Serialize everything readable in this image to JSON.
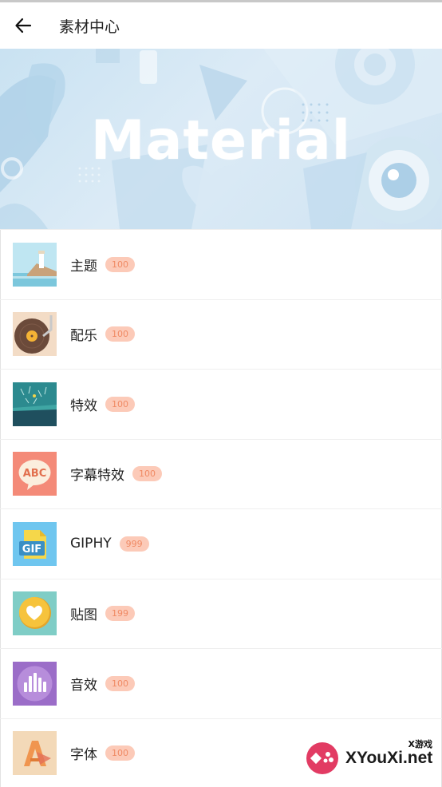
{
  "header": {
    "title": "素材中心",
    "back_icon": "arrow-left-icon"
  },
  "banner": {
    "text": "Material"
  },
  "items": [
    {
      "label": "主题",
      "count": "100",
      "icon": "theme-lighthouse-icon"
    },
    {
      "label": "配乐",
      "count": "100",
      "icon": "music-record-icon"
    },
    {
      "label": "特效",
      "count": "100",
      "icon": "effects-icon"
    },
    {
      "label": "字幕特效",
      "count": "100",
      "icon": "subtitle-abc-icon"
    },
    {
      "label": "GIPHY",
      "count": "999",
      "icon": "gif-icon"
    },
    {
      "label": "贴图",
      "count": "199",
      "icon": "sticker-heart-icon"
    },
    {
      "label": "音效",
      "count": "100",
      "icon": "sound-bars-icon"
    },
    {
      "label": "字体",
      "count": "100",
      "icon": "font-letter-icon"
    }
  ],
  "watermark": {
    "text": "XYouXi.net",
    "small": "X游戏"
  },
  "colors": {
    "badge_bg": "#fccab8",
    "badge_text": "#f08a64",
    "banner_bg": "#d6e8f4"
  }
}
